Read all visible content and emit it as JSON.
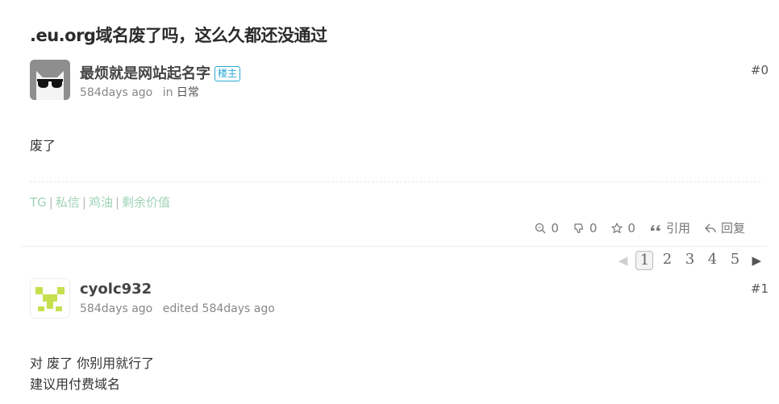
{
  "topic": {
    "title": ".eu.org域名废了吗，这么久都还没通过"
  },
  "post0": {
    "author": "最烦就是网站起名字",
    "badge": "楼主",
    "time": "584days ago",
    "in_label": "in",
    "node": "日常",
    "floor": "#0",
    "content": "废了"
  },
  "signature": {
    "links": [
      "TG",
      "私信",
      "鸡油",
      "剩余价值"
    ],
    "separator": "|"
  },
  "actions": {
    "like_count": "0",
    "dislike_count": "0",
    "star_count": "0",
    "quote_label": "引用",
    "reply_label": "回复"
  },
  "pagination": {
    "pages": [
      "1",
      "2",
      "3",
      "4",
      "5"
    ],
    "current": "1",
    "prev_icon": "◀",
    "next_icon": "▶"
  },
  "post1": {
    "author": "cyolc932",
    "time": "584days ago",
    "edited": "edited 584days ago",
    "floor": "#1",
    "content_lines": [
      "对 废了 你别用就行了",
      "建议用付费域名"
    ]
  },
  "colors": {
    "signature_green": "#9fd3b5",
    "badge_blue": "#2aa9d6",
    "identicon_green": "#c4e04f"
  }
}
